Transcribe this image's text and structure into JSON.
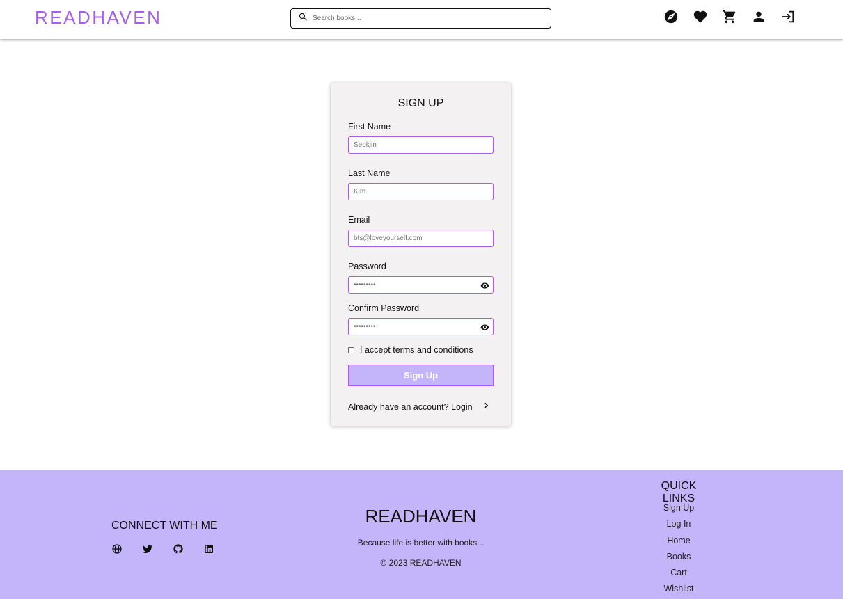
{
  "header": {
    "logo": "READHAVEN",
    "search_placeholder": "Search books...",
    "icons": [
      "explore-icon",
      "heart-icon",
      "cart-icon",
      "person-icon",
      "login-icon"
    ]
  },
  "form": {
    "title": "SIGN UP",
    "first_name": {
      "label": "First Name",
      "placeholder": "Seokjin"
    },
    "last_name": {
      "label": "Last Name",
      "placeholder": "Kim"
    },
    "email": {
      "label": "Email",
      "placeholder": "bts@loveyourself.com"
    },
    "password": {
      "label": "Password",
      "placeholder": "•••••••••"
    },
    "confirm_password": {
      "label": "Confirm Password",
      "placeholder": "•••••••••"
    },
    "terms_label": "I accept terms and conditions",
    "submit_label": "Sign Up",
    "login_prompt": "Already have an account? Login"
  },
  "footer": {
    "connect_title": "CONNECT WITH ME",
    "social_icons": [
      "globe-icon",
      "twitter-icon",
      "github-icon",
      "linkedin-icon"
    ],
    "brand": "READHAVEN",
    "tagline": "Because life is better with books...",
    "copyright": "© 2023 READHAVEN",
    "quick_links_title": "QUICK LINKS",
    "quick_links": [
      "Sign Up",
      "Log In",
      "Home",
      "Books",
      "Cart",
      "Wishlist"
    ]
  },
  "colors": {
    "accent": "#a55ef0",
    "footer_bg": "#c4b5fa",
    "card_bg": "#f4f1f2",
    "button_bg": "#c4b5fa"
  }
}
